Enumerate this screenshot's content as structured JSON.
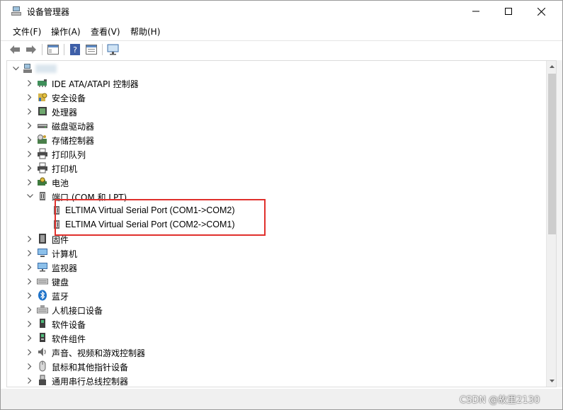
{
  "window": {
    "title": "设备管理器"
  },
  "menu": [
    {
      "label": "文件(F)"
    },
    {
      "label": "操作(A)"
    },
    {
      "label": "查看(V)"
    },
    {
      "label": "帮助(H)"
    }
  ],
  "tree": {
    "root_label": "",
    "items": [
      {
        "label": "IDE ATA/ATAPI 控制器",
        "icon": "ide-controller-icon",
        "expanded": false
      },
      {
        "label": "安全设备",
        "icon": "security-device-icon",
        "expanded": false
      },
      {
        "label": "处理器",
        "icon": "processor-icon",
        "expanded": false
      },
      {
        "label": "磁盘驱动器",
        "icon": "disk-drive-icon",
        "expanded": false
      },
      {
        "label": "存储控制器",
        "icon": "storage-controller-icon",
        "expanded": false
      },
      {
        "label": "打印队列",
        "icon": "print-queue-icon",
        "expanded": false
      },
      {
        "label": "打印机",
        "icon": "printer-icon",
        "expanded": false
      },
      {
        "label": "电池",
        "icon": "battery-icon",
        "expanded": false
      },
      {
        "label": "端口 (COM 和 LPT)",
        "icon": "port-icon",
        "expanded": true,
        "children": [
          {
            "label": "ELTIMA Virtual Serial Port (COM1->COM2)",
            "icon": "serial-port-icon"
          },
          {
            "label": "ELTIMA Virtual Serial Port (COM2->COM1)",
            "icon": "serial-port-icon"
          }
        ]
      },
      {
        "label": "固件",
        "icon": "firmware-icon",
        "expanded": false
      },
      {
        "label": "计算机",
        "icon": "computer-icon",
        "expanded": false
      },
      {
        "label": "监视器",
        "icon": "monitor-icon",
        "expanded": false
      },
      {
        "label": "键盘",
        "icon": "keyboard-icon",
        "expanded": false
      },
      {
        "label": "蓝牙",
        "icon": "bluetooth-icon",
        "expanded": false
      },
      {
        "label": "人机接口设备",
        "icon": "hid-icon",
        "expanded": false
      },
      {
        "label": "软件设备",
        "icon": "software-device-icon",
        "expanded": false
      },
      {
        "label": "软件组件",
        "icon": "software-component-icon",
        "expanded": false
      },
      {
        "label": "声音、视频和游戏控制器",
        "icon": "sound-icon",
        "expanded": false
      },
      {
        "label": "鼠标和其他指针设备",
        "icon": "mouse-icon",
        "expanded": false
      },
      {
        "label": "通用串行总线控制器",
        "icon": "usb-icon",
        "expanded": false
      }
    ]
  },
  "watermark": "CSDN @故里2130",
  "colors": {
    "highlight": "#e0302c",
    "scrollbar_thumb": "#cdcdcd"
  }
}
